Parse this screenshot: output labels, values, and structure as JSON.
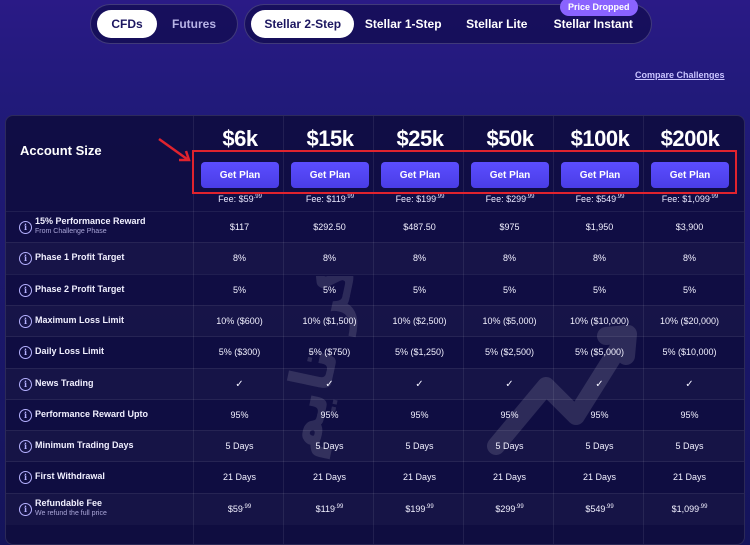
{
  "markets": [
    {
      "label": "CFDs",
      "active": true
    },
    {
      "label": "Futures",
      "active": false
    }
  ],
  "programs": [
    {
      "label": "Stellar 2-Step",
      "active": true
    },
    {
      "label": "Stellar 1-Step",
      "active": false
    },
    {
      "label": "Stellar Lite",
      "active": false
    },
    {
      "label": "Stellar Instant",
      "active": false
    }
  ],
  "badge": "Price Dropped",
  "compare": "Compare Challenges",
  "table": {
    "header_label": "Account Size",
    "button_label": "Get Plan",
    "plans": [
      {
        "size": "$6k",
        "fee": "Fee: $59",
        "fee_cents": ".99"
      },
      {
        "size": "$15k",
        "fee": "Fee: $119",
        "fee_cents": ".99"
      },
      {
        "size": "$25k",
        "fee": "Fee: $199",
        "fee_cents": ".99"
      },
      {
        "size": "$50k",
        "fee": "Fee: $299",
        "fee_cents": ".99"
      },
      {
        "size": "$100k",
        "fee": "Fee: $549",
        "fee_cents": ".99"
      },
      {
        "size": "$200k",
        "fee": "Fee: $1,099",
        "fee_cents": ".99"
      }
    ],
    "rows": [
      {
        "label": "15% Performance Reward",
        "sub": "From Challenge Phase",
        "values": [
          "$117",
          "$292.50",
          "$487.50",
          "$975",
          "$1,950",
          "$3,900"
        ]
      },
      {
        "label": "Phase 1 Profit Target",
        "sub": "",
        "values": [
          "8%",
          "8%",
          "8%",
          "8%",
          "8%",
          "8%"
        ]
      },
      {
        "label": "Phase 2 Profit Target",
        "sub": "",
        "values": [
          "5%",
          "5%",
          "5%",
          "5%",
          "5%",
          "5%"
        ]
      },
      {
        "label": "Maximum Loss Limit",
        "sub": "",
        "values": [
          "10% ($600)",
          "10% ($1,500)",
          "10% ($2,500)",
          "10% ($5,000)",
          "10% ($10,000)",
          "10% ($20,000)"
        ]
      },
      {
        "label": "Daily Loss Limit",
        "sub": "",
        "values": [
          "5% ($300)",
          "5% ($750)",
          "5% ($1,250)",
          "5% ($2,500)",
          "5% ($5,000)",
          "5% ($10,000)"
        ]
      },
      {
        "label": "News Trading",
        "sub": "",
        "values": [
          "✓",
          "✓",
          "✓",
          "✓",
          "✓",
          "✓"
        ]
      },
      {
        "label": "Performance Reward Upto",
        "sub": "",
        "values": [
          "95%",
          "95%",
          "95%",
          "95%",
          "95%",
          "95%"
        ]
      },
      {
        "label": "Minimum Trading Days",
        "sub": "",
        "values": [
          "5 Days",
          "5 Days",
          "5 Days",
          "5 Days",
          "5 Days",
          "5 Days"
        ]
      },
      {
        "label": "First Withdrawal",
        "sub": "",
        "values": [
          "21 Days",
          "21 Days",
          "21 Days",
          "21 Days",
          "21 Days",
          "21 Days"
        ]
      },
      {
        "label": "Refundable Fee",
        "sub": "We refund the full price",
        "values": [
          "$59",
          "$119",
          "$199",
          "$299",
          "$549",
          "$1,099"
        ],
        "cents": ".99"
      }
    ]
  },
  "watermark": "بروکر تایم"
}
